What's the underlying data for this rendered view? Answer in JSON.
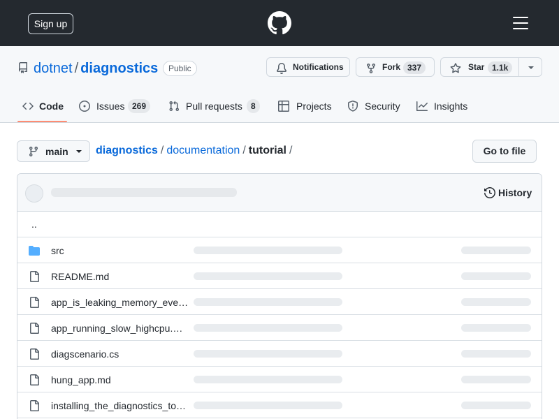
{
  "header": {
    "signup_label": "Sign up",
    "logo_icon": "github-logo-icon",
    "menu_icon": "hamburger-menu-icon"
  },
  "repo": {
    "owner": "dotnet",
    "separator": "/",
    "name": "diagnostics",
    "visibility": "Public",
    "notifications_label": "Notifications",
    "fork_label": "Fork",
    "fork_count": "337",
    "star_label": "Star",
    "star_count": "1.1k"
  },
  "tabs": [
    {
      "label": "Code",
      "icon": "code-icon",
      "active": true
    },
    {
      "label": "Issues",
      "icon": "issue-circle-icon",
      "count": "269"
    },
    {
      "label": "Pull requests",
      "icon": "pull-request-icon",
      "count": "8"
    },
    {
      "label": "Projects",
      "icon": "table-icon"
    },
    {
      "label": "Security",
      "icon": "shield-icon"
    },
    {
      "label": "Insights",
      "icon": "graph-icon"
    }
  ],
  "branch": {
    "label": "main"
  },
  "breadcrumb": {
    "root": "diagnostics",
    "sep": "/",
    "folder": "documentation",
    "current": "tutorial"
  },
  "goto_file_label": "Go to file",
  "history_label": "History",
  "parent_dir": "..",
  "files": [
    {
      "name": "src",
      "type": "folder"
    },
    {
      "name": "README.md",
      "type": "file"
    },
    {
      "name": "app_is_leaking_memory_eve…",
      "type": "file"
    },
    {
      "name": "app_running_slow_highcpu.…",
      "type": "file"
    },
    {
      "name": "diagscenario.cs",
      "type": "file"
    },
    {
      "name": "hung_app.md",
      "type": "file"
    },
    {
      "name": "installing_the_diagnostics_to…",
      "type": "file"
    }
  ],
  "colors": {
    "header_bg": "#24292f",
    "link": "#0969da",
    "folder": "#54aeff",
    "active_tab_underline": "#fd8c73"
  }
}
